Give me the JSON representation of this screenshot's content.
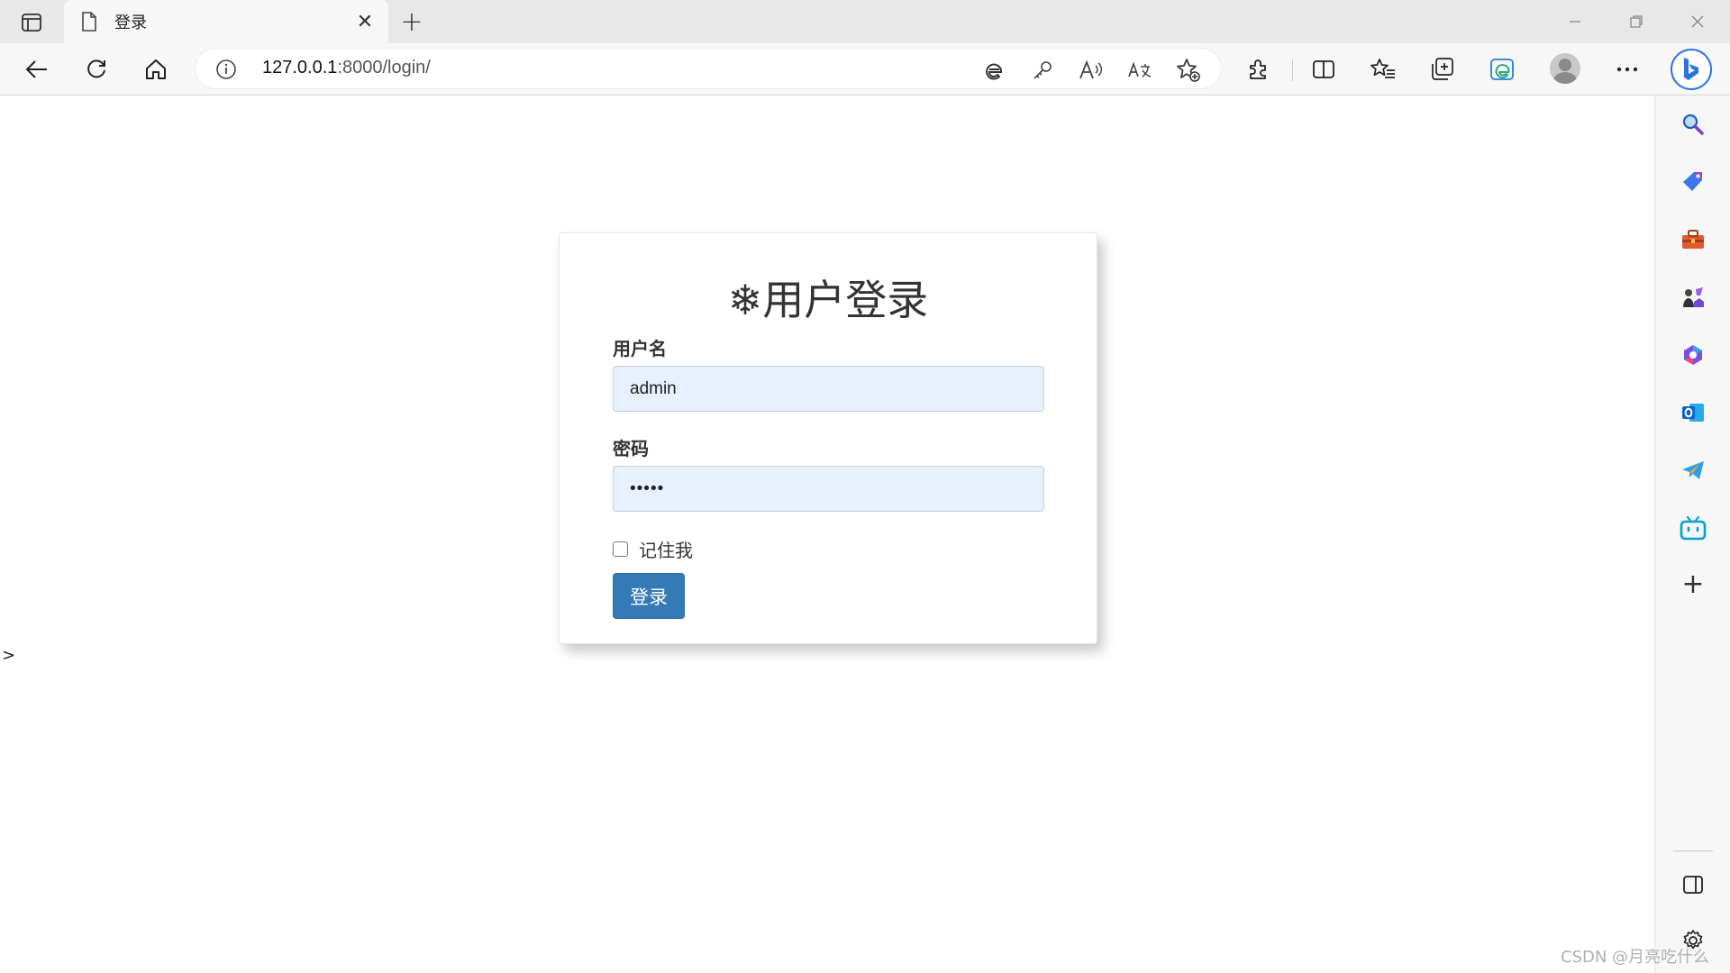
{
  "browser": {
    "tab": {
      "title": "登录",
      "close_glyph": "✕"
    },
    "new_tab_glyph": "+",
    "address": {
      "host": "127.0.0.1",
      "rest": ":8000/login/"
    },
    "sidebar_add_glyph": "+"
  },
  "login": {
    "title": "❄用户登录",
    "username_label": "用户名",
    "username_value": "admin",
    "password_label": "密码",
    "password_value": "•••••",
    "remember_label": "记住我",
    "submit_label": "登录"
  },
  "page": {
    "stray_text": ">"
  },
  "watermark": "CSDN @月亮吃什么",
  "colors": {
    "primary_button": "#337ab7",
    "input_autofill_bg": "#e8f0fe",
    "bing_blue": "#2b74e4"
  },
  "icons": {
    "toolbar": [
      "back-icon",
      "refresh-icon",
      "home-icon",
      "info-icon",
      "ie-mode-icon",
      "key-icon",
      "read-aloud-icon",
      "translate-icon",
      "add-favorite-icon",
      "extensions-icon",
      "split-screen-icon",
      "favorites-icon",
      "collections-icon",
      "edge-drop-icon",
      "more-icon"
    ],
    "sidebar": [
      "search-icon",
      "shopping-tag-icon",
      "toolbox-icon",
      "games-icon",
      "office-icon",
      "outlook-icon",
      "telegram-icon",
      "bilibili-icon",
      "add-icon",
      "sidebar-toggle-icon",
      "settings-icon"
    ]
  }
}
